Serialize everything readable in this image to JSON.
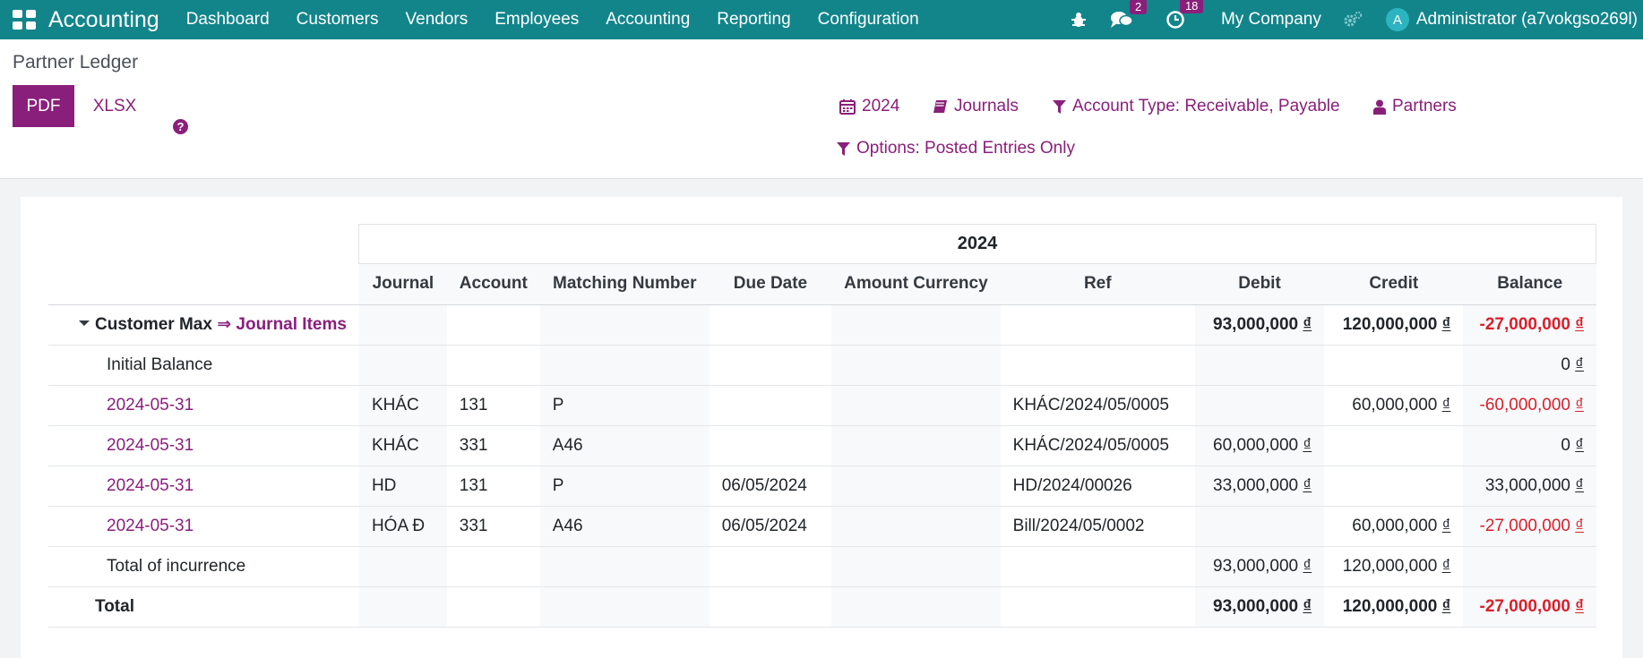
{
  "navbar": {
    "app_name": "Accounting",
    "menu": [
      "Dashboard",
      "Customers",
      "Vendors",
      "Employees",
      "Accounting",
      "Reporting",
      "Configuration"
    ],
    "messages_badge": "2",
    "activities_badge": "18",
    "company": "My Company",
    "avatar_letter": "A",
    "user": "Administrator (a7vokgso269l)"
  },
  "control_panel": {
    "breadcrumb": "Partner Ledger",
    "pdf_label": "PDF",
    "xlsx_label": "XLSX",
    "help_icon": "?",
    "filters": {
      "date": "2024",
      "journals": "Journals",
      "account_type": "Account Type: Receivable, Payable",
      "partners": "Partners",
      "options": "Options: Posted Entries Only"
    }
  },
  "report": {
    "period_header": "2024",
    "columns": [
      "Journal",
      "Account",
      "Matching Number",
      "Due Date",
      "Amount Currency",
      "Ref",
      "Debit",
      "Credit",
      "Balance"
    ],
    "partner": {
      "name": "Customer Max",
      "arrow": "⇒",
      "link": "Journal Items",
      "debit": "93,000,000",
      "credit": "120,000,000",
      "balance": "-27,000,000"
    },
    "initial_balance": {
      "label": "Initial Balance",
      "balance": "0"
    },
    "lines": [
      {
        "date": "2024-05-31",
        "journal": "KHÁC",
        "account": "131",
        "matching": "P",
        "due": "",
        "amount_currency": "",
        "ref": "KHÁC/2024/05/0005",
        "debit": "",
        "credit": "60,000,000",
        "balance": "-60,000,000",
        "neg": true
      },
      {
        "date": "2024-05-31",
        "journal": "KHÁC",
        "account": "331",
        "matching": "A46",
        "due": "",
        "amount_currency": "",
        "ref": "KHÁC/2024/05/0005",
        "debit": "60,000,000",
        "credit": "",
        "balance": "0",
        "neg": false
      },
      {
        "date": "2024-05-31",
        "journal": "HD",
        "account": "131",
        "matching": "P",
        "due": "06/05/2024",
        "amount_currency": "",
        "ref": "HD/2024/00026",
        "debit": "33,000,000",
        "credit": "",
        "balance": "33,000,000",
        "neg": false
      },
      {
        "date": "2024-05-31",
        "journal": "HÓA Đ",
        "account": "331",
        "matching": "A46",
        "due": "06/05/2024",
        "amount_currency": "",
        "ref": "Bill/2024/05/0002",
        "debit": "",
        "credit": "60,000,000",
        "balance": "-27,000,000",
        "neg": true
      }
    ],
    "total_incurrence": {
      "label": "Total of incurrence",
      "debit": "93,000,000",
      "credit": "120,000,000"
    },
    "total": {
      "label": "Total",
      "debit": "93,000,000",
      "credit": "120,000,000",
      "balance": "-27,000,000"
    },
    "currency_symbol": "₫"
  },
  "colors": {
    "navbar": "#12858b",
    "accent": "#8a1f7b",
    "negative": "#d9202c"
  }
}
